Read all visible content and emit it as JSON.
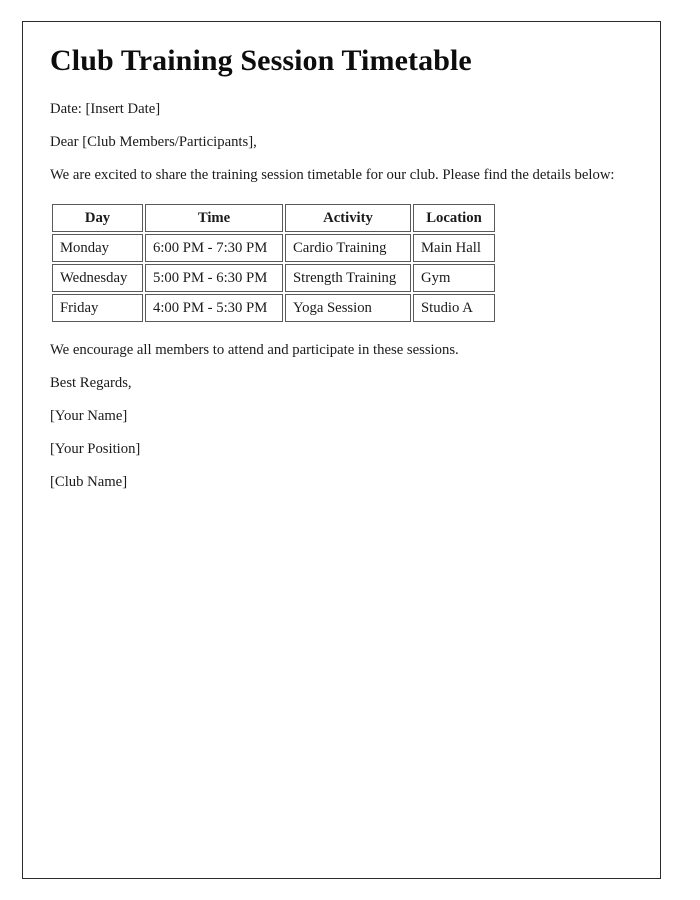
{
  "document": {
    "title": "Club Training Session Timetable",
    "date_line": "Date: [Insert Date]",
    "salutation": "Dear [Club Members/Participants],",
    "intro": "We are excited to share the training session timetable for our club. Please find the details below:",
    "encouragement": "We encourage all members to attend and participate in these sessions.",
    "sign_off": "Best Regards,",
    "signature_name": "[Your Name]",
    "signature_position": "[Your Position]",
    "signature_club": "[Club Name]"
  },
  "timetable": {
    "headers": [
      "Day",
      "Time",
      "Activity",
      "Location"
    ],
    "rows": [
      {
        "day": "Monday",
        "time": "6:00 PM - 7:30 PM",
        "activity": "Cardio Training",
        "location": "Main Hall"
      },
      {
        "day": "Wednesday",
        "time": "5:00 PM - 6:30 PM",
        "activity": "Strength Training",
        "location": "Gym"
      },
      {
        "day": "Friday",
        "time": "4:00 PM - 5:30 PM",
        "activity": "Yoga Session",
        "location": "Studio A"
      }
    ]
  },
  "style": {
    "page_border_color": "#2b2b2b",
    "table_border_color": "#5a5a5a",
    "text_color": "#1a1a1a",
    "background_color": "#ffffff"
  }
}
